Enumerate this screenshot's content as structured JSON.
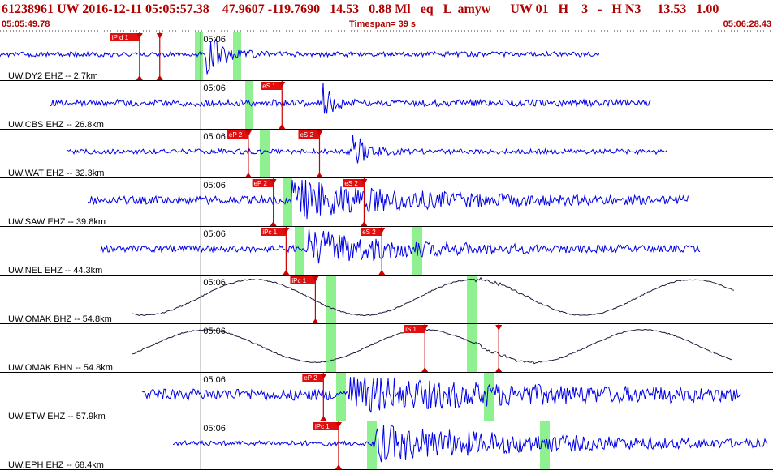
{
  "header": {
    "event_line": "61238961 UW 2016-12-11 05:05:57.38    47.9607 -119.7690   14.53   0.88 Ml   eq   L  amyw      UW 01   H    3   -   H N3     13.53   1.00",
    "window_start": "05:05:49.78",
    "timespan_label": "Timespan=",
    "timespan_value": " 39 s",
    "window_end": "05:06:28.43"
  },
  "colors": {
    "header_text": "#b00000",
    "trace_velocity": "#0000e6",
    "trace_broadband": "#1a1a3a",
    "pick_label_bg": "#e01010",
    "pick_line": "#cc0000",
    "window_band": "#8ef08e"
  },
  "trace_tick_label": "05:06",
  "traces": [
    {
      "station_label": "UW.DY2 EHZ -- 2.7km",
      "type": "velocity",
      "picks": [
        {
          "label": "iP d 1",
          "time": 56.88
        },
        {
          "label": "",
          "time": 57.91
        }
      ]
    },
    {
      "station_label": "UW.CBS EHZ -- 26.8km",
      "type": "velocity",
      "picks": [
        {
          "label": "eS 1",
          "time": 64.13
        }
      ]
    },
    {
      "station_label": "UW.WAT EHZ -- 32.3km",
      "type": "velocity",
      "picks": [
        {
          "label": "eP 2",
          "time": 62.42
        },
        {
          "label": "eS 2",
          "time": 66.04
        }
      ]
    },
    {
      "station_label": "UW.SAW EHZ -- 39.8km",
      "type": "velocity",
      "picks": [
        {
          "label": "eP 2",
          "time": 63.69
        },
        {
          "label": "eS 2",
          "time": 68.31
        }
      ]
    },
    {
      "station_label": "UW.NEL EHZ -- 44.3km",
      "type": "velocity",
      "picks": [
        {
          "label": "iPc 1",
          "time": 64.34
        },
        {
          "label": "eS 2",
          "time": 69.21
        }
      ]
    },
    {
      "station_label": "UW.OMAK BHZ -- 54.8km",
      "type": "broadband",
      "picks": [
        {
          "label": "iPc 1",
          "time": 65.83
        }
      ]
    },
    {
      "station_label": "UW.OMAK BHN -- 54.8km",
      "type": "broadband",
      "picks": [
        {
          "label": "iS 1",
          "time": 71.4
        },
        {
          "label": "",
          "time": 75.16
        }
      ]
    },
    {
      "station_label": "UW.ETW EHZ -- 57.9km",
      "type": "velocity",
      "picks": [
        {
          "label": "eP 2",
          "time": 66.24
        }
      ]
    },
    {
      "station_label": "UW.EPH EHZ -- 68.4km",
      "type": "velocity",
      "picks": [
        {
          "label": "iPc 1",
          "time": 67.01
        }
      ]
    }
  ]
}
